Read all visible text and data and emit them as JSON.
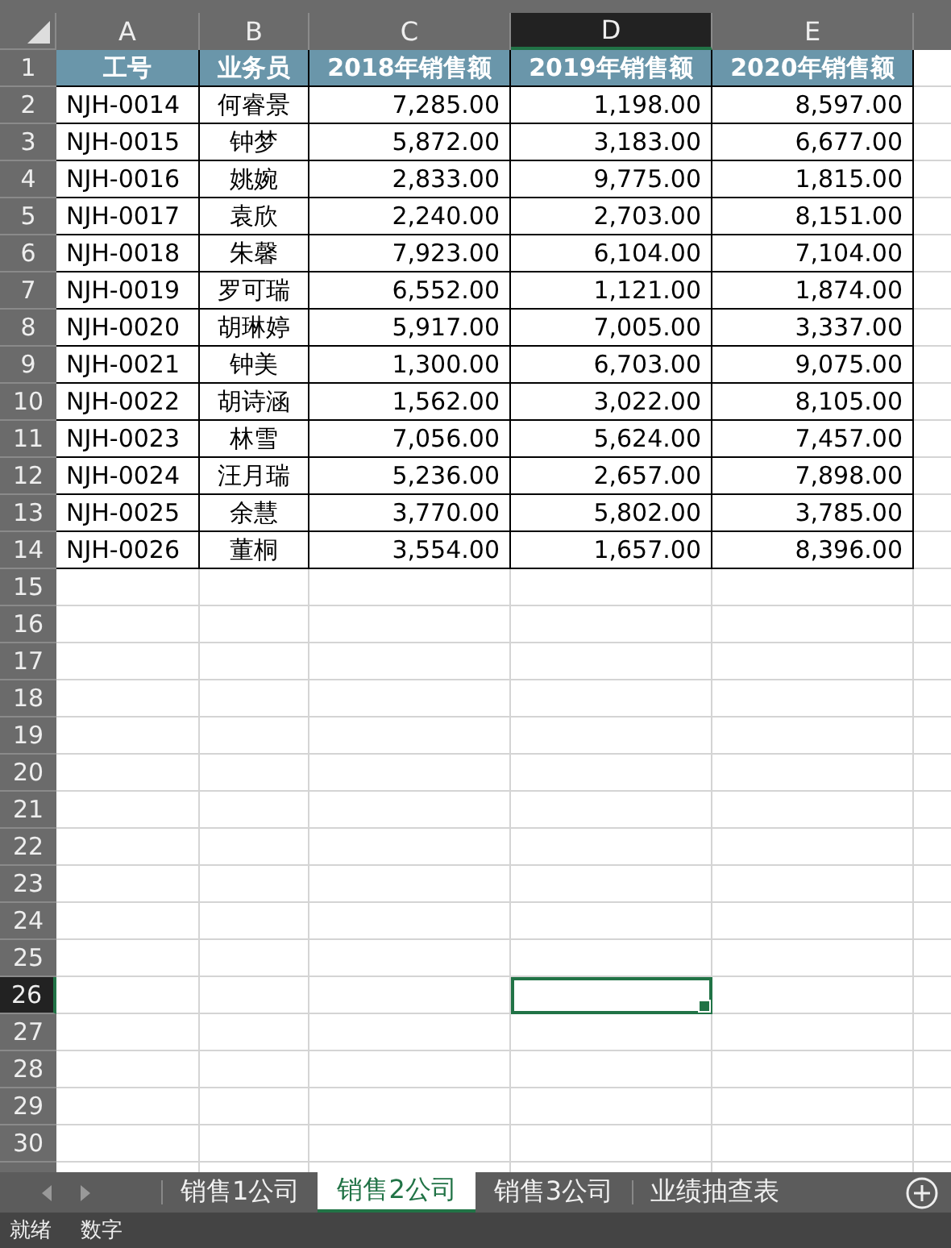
{
  "column_headers": [
    {
      "label": "A",
      "selected": false
    },
    {
      "label": "B",
      "selected": false
    },
    {
      "label": "C",
      "selected": false
    },
    {
      "label": "D",
      "selected": true
    },
    {
      "label": "E",
      "selected": false
    }
  ],
  "row_numbers": [
    {
      "label": "1",
      "selected": false
    },
    {
      "label": "2",
      "selected": false
    },
    {
      "label": "3",
      "selected": false
    },
    {
      "label": "4",
      "selected": false
    },
    {
      "label": "5",
      "selected": false
    },
    {
      "label": "6",
      "selected": false
    },
    {
      "label": "7",
      "selected": false
    },
    {
      "label": "8",
      "selected": false
    },
    {
      "label": "9",
      "selected": false
    },
    {
      "label": "10",
      "selected": false
    },
    {
      "label": "11",
      "selected": false
    },
    {
      "label": "12",
      "selected": false
    },
    {
      "label": "13",
      "selected": false
    },
    {
      "label": "14",
      "selected": false
    },
    {
      "label": "15",
      "selected": false
    },
    {
      "label": "16",
      "selected": false
    },
    {
      "label": "17",
      "selected": false
    },
    {
      "label": "18",
      "selected": false
    },
    {
      "label": "19",
      "selected": false
    },
    {
      "label": "20",
      "selected": false
    },
    {
      "label": "21",
      "selected": false
    },
    {
      "label": "22",
      "selected": false
    },
    {
      "label": "23",
      "selected": false
    },
    {
      "label": "24",
      "selected": false
    },
    {
      "label": "25",
      "selected": false
    },
    {
      "label": "26",
      "selected": true
    },
    {
      "label": "27",
      "selected": false
    },
    {
      "label": "28",
      "selected": false
    },
    {
      "label": "29",
      "selected": false
    },
    {
      "label": "30",
      "selected": false
    }
  ],
  "table": {
    "header": [
      "工号",
      "业务员",
      "2018年销售额",
      "2019年销售额",
      "2020年销售额"
    ],
    "rows": [
      [
        "NJH-0014",
        "何睿景",
        "7,285.00",
        "1,198.00",
        "8,597.00"
      ],
      [
        "NJH-0015",
        "钟梦",
        "5,872.00",
        "3,183.00",
        "6,677.00"
      ],
      [
        "NJH-0016",
        "姚婉",
        "2,833.00",
        "9,775.00",
        "1,815.00"
      ],
      [
        "NJH-0017",
        "袁欣",
        "2,240.00",
        "2,703.00",
        "8,151.00"
      ],
      [
        "NJH-0018",
        "朱馨",
        "7,923.00",
        "6,104.00",
        "7,104.00"
      ],
      [
        "NJH-0019",
        "罗可瑞",
        "6,552.00",
        "1,121.00",
        "1,874.00"
      ],
      [
        "NJH-0020",
        "胡琳婷",
        "5,917.00",
        "7,005.00",
        "3,337.00"
      ],
      [
        "NJH-0021",
        "钟美",
        "1,300.00",
        "6,703.00",
        "9,075.00"
      ],
      [
        "NJH-0022",
        "胡诗涵",
        "1,562.00",
        "3,022.00",
        "8,105.00"
      ],
      [
        "NJH-0023",
        "林雪",
        "7,056.00",
        "5,624.00",
        "7,457.00"
      ],
      [
        "NJH-0024",
        "汪月瑞",
        "5,236.00",
        "2,657.00",
        "7,898.00"
      ],
      [
        "NJH-0025",
        "余慧",
        "3,770.00",
        "5,802.00",
        "3,785.00"
      ],
      [
        "NJH-0026",
        "董桐",
        "3,554.00",
        "1,657.00",
        "8,396.00"
      ]
    ]
  },
  "sheet_tabs": [
    {
      "label": "销售1公司",
      "selected": false
    },
    {
      "label": "销售2公司",
      "selected": true
    },
    {
      "label": "销售3公司",
      "selected": false
    },
    {
      "label": "业绩抽查表",
      "selected": false
    }
  ],
  "status_bar": [
    "就绪",
    "数字"
  ]
}
